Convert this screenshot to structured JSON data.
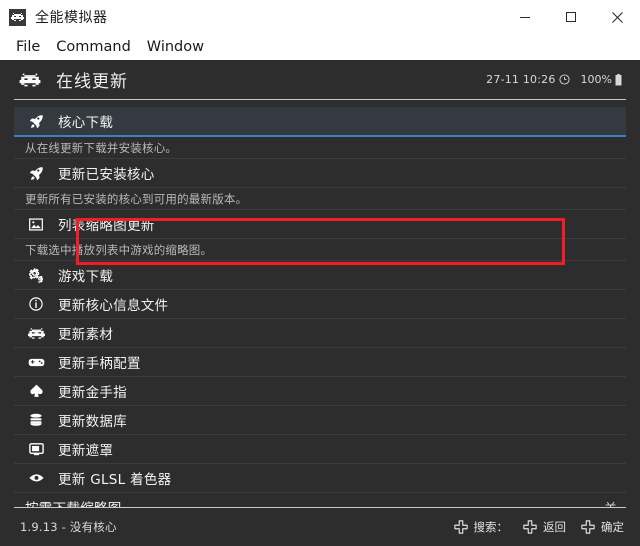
{
  "window": {
    "title": "全能模拟器",
    "icon": "invader-icon",
    "controls": {
      "minimize": "minimize-icon",
      "maximize": "maximize-icon",
      "close": "close-icon"
    }
  },
  "menubar": {
    "items": [
      {
        "label": "File"
      },
      {
        "label": "Command"
      },
      {
        "label": "Window"
      }
    ]
  },
  "panel": {
    "header": {
      "icon": "invader-icon",
      "title": "在线更新",
      "clock": "27-11 10:26",
      "clock_icon": "clock-icon",
      "battery": "100%",
      "battery_icon": "battery-icon"
    },
    "entries": [
      {
        "icon": "rocket-icon",
        "label": "核心下载",
        "desc": "从在线更新下载并安装核心。",
        "selected": true,
        "value": ""
      },
      {
        "icon": "rocket-icon",
        "label": "更新已安装核心",
        "desc": "更新所有已安装的核心到可用的最新版本。",
        "selected": false,
        "value": ""
      },
      {
        "icon": "image-icon",
        "label": "列表缩略图更新",
        "desc": "下载选中播放列表中游戏的缩略图。",
        "selected": false,
        "value": ""
      },
      {
        "icon": "gears-icon",
        "label": "游戏下载",
        "desc": "",
        "selected": false,
        "value": ""
      },
      {
        "icon": "info-icon",
        "label": "更新核心信息文件",
        "desc": "",
        "selected": false,
        "value": ""
      },
      {
        "icon": "invader-icon",
        "label": "更新素材",
        "desc": "",
        "selected": false,
        "value": ""
      },
      {
        "icon": "gamepad-icon",
        "label": "更新手柄配置",
        "desc": "",
        "selected": false,
        "value": ""
      },
      {
        "icon": "spade-icon",
        "label": "更新金手指",
        "desc": "",
        "selected": false,
        "value": ""
      },
      {
        "icon": "database-icon",
        "label": "更新数据库",
        "desc": "",
        "selected": false,
        "value": ""
      },
      {
        "icon": "monitor-icon",
        "label": "更新遮罩",
        "desc": "",
        "selected": false,
        "value": ""
      },
      {
        "icon": "eye-icon",
        "label": "更新 GLSL 着色器",
        "desc": "",
        "selected": false,
        "value": ""
      },
      {
        "icon": "",
        "label": "按需下载缩略图",
        "desc": "",
        "selected": false,
        "value": "关"
      }
    ],
    "footer": {
      "status": "1.9.13 - 没有核心",
      "actions": [
        {
          "icon": "dpad-icon",
          "label": "搜索："
        },
        {
          "icon": "dpad-icon",
          "label": "返回"
        },
        {
          "icon": "dpad-icon",
          "label": "确定"
        }
      ]
    }
  },
  "colors": {
    "panel_bg": "#2d2d2d",
    "selection_bg": "#343a40",
    "selection_underline": "#3f7fbf",
    "annotation_red": "#f41c28"
  }
}
